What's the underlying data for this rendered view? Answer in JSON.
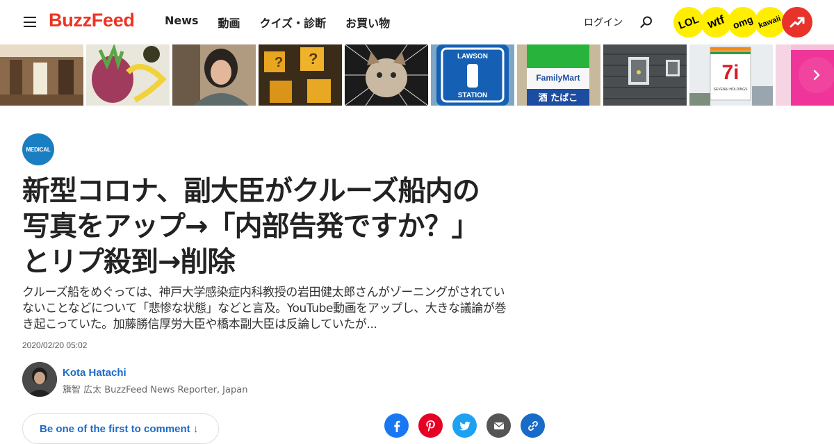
{
  "header": {
    "logo": "BuzzFeed",
    "nav": [
      "News",
      "動画",
      "クイズ・診断",
      "お買い物"
    ],
    "login": "ログイン",
    "badges": [
      "LOL",
      "wtf",
      "omg",
      "kawaii"
    ]
  },
  "colors": {
    "brand": "#ee3322",
    "link": "#1a6bc8",
    "badge": "#ffee00",
    "trending": "#e8322a",
    "category": "#1a7fc2"
  },
  "thumbs": [
    {
      "store_label": ""
    },
    {
      "store_label": ""
    },
    {
      "store_label": ""
    },
    {
      "store_label": ""
    },
    {
      "store_label": ""
    },
    {
      "store_label": "LAWSON STATION"
    },
    {
      "store_label": "FamilyMart",
      "sub_label": "酒 たばこ"
    },
    {
      "store_label": ""
    },
    {
      "store_label": "7i",
      "sub_label": "SEVEN&i HOLDINGS"
    },
    {
      "store_label": ""
    }
  ],
  "article": {
    "category": "MEDICAL",
    "headline_lines": [
      "新型コロナ、副大臣がクルーズ船内の",
      "写真をアップ→「内部告発ですか？」",
      "とリプ殺到→削除"
    ],
    "dek_lines": [
      "クルーズ船をめぐっては、神戸大学感染症内科教授の岩田健太郎さんがゾーニングがされてい",
      "ないことなどについて「悲惨な状態」などと言及。YouTube動画をアップし、大きな議論が巻",
      "き起こっていた。加藤勝信厚労大臣や橋本副大臣は反論していたが..."
    ],
    "timestamp": "2020/02/20 05:02",
    "author_name": "Kota Hatachi",
    "author_title": "籏智 広太 BuzzFeed News Reporter, Japan",
    "comment_label": "Be one of the first to comment ↓"
  }
}
